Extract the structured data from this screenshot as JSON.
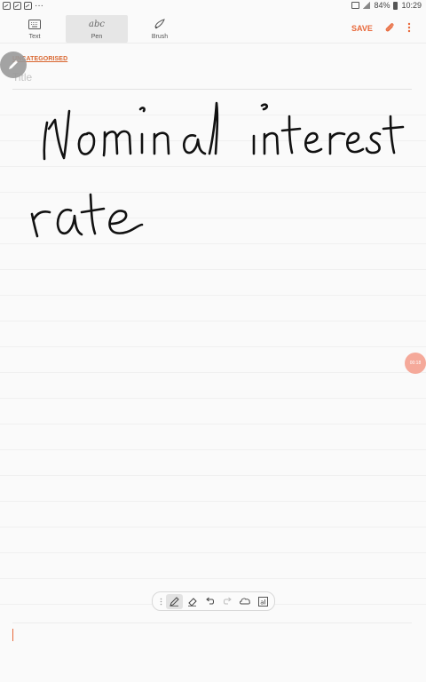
{
  "status_bar": {
    "notification_icons": [
      "gallery-icon",
      "gallery-icon",
      "gallery-icon"
    ],
    "more_indicator": "···",
    "battery": "84%",
    "time": "10:29"
  },
  "toolbar": {
    "tabs": [
      {
        "label": "Text",
        "icon": "keyboard-icon",
        "active": false
      },
      {
        "label": "Pen",
        "icon_text": "abc",
        "active": true
      },
      {
        "label": "Brush",
        "icon": "brush-icon",
        "active": false
      }
    ],
    "save_label": "SAVE"
  },
  "note": {
    "category": "UNCATEGORISED",
    "title_placeholder": "Title",
    "handwritten_lines": [
      "Nominal interest",
      "rate"
    ]
  },
  "recording_badge": "00:18",
  "pen_toolbar": {
    "tools": [
      "pen-icon",
      "eraser-icon",
      "undo-icon",
      "redo-icon",
      "lasso-icon",
      "convert-text-icon"
    ],
    "active_tool": "pen-icon"
  },
  "colors": {
    "accent": "#e8683a",
    "active_tab_bg": "#e6e6e6",
    "ink": "#111111"
  }
}
